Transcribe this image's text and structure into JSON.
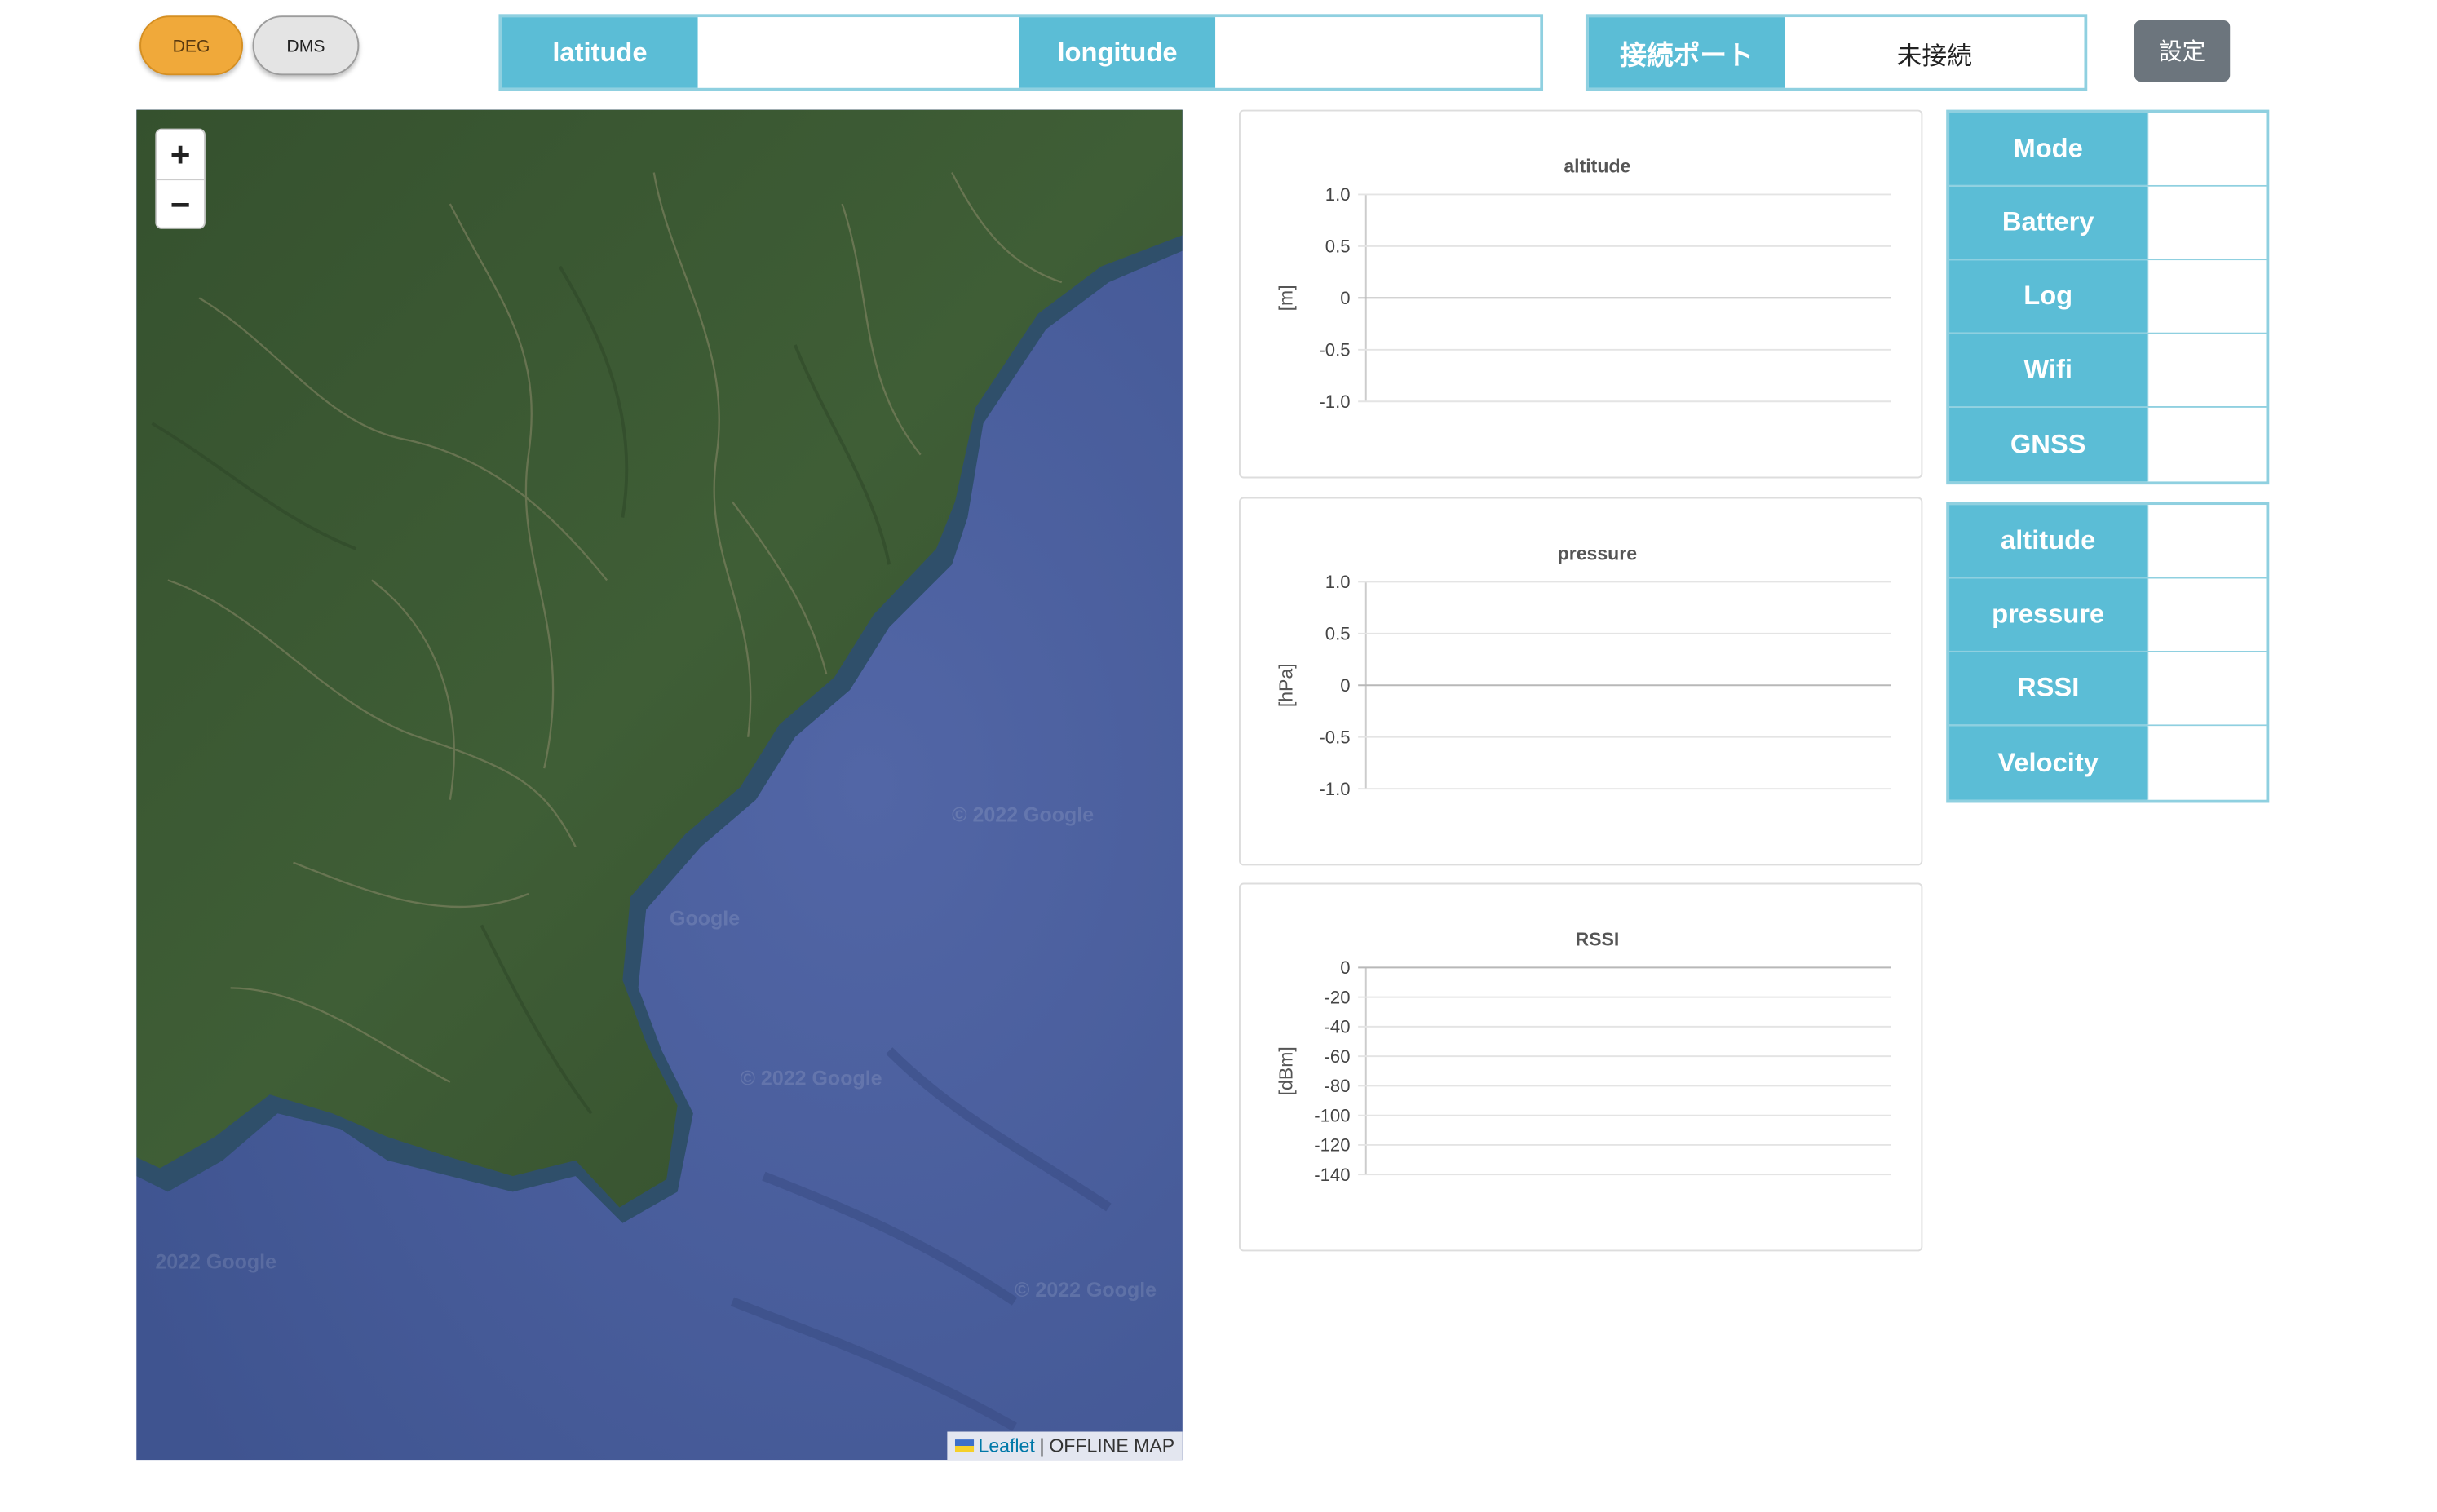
{
  "format_toggle": {
    "deg_label": "DEG",
    "dms_label": "DMS",
    "active": "DEG"
  },
  "coords": {
    "latitude_label": "latitude",
    "latitude_value": "",
    "longitude_label": "longitude",
    "longitude_value": ""
  },
  "port": {
    "label": "接続ポート",
    "value": "未接続"
  },
  "settings_button": "設定",
  "map": {
    "zoom_in": "+",
    "zoom_out": "−",
    "attribution_link": "Leaflet",
    "attribution_sep": "|",
    "attribution_text": "OFFLINE MAP",
    "watermarks": [
      "© 2022 Google",
      "Google",
      "© 2022 Google",
      "2022 Google",
      "© 2022 Google"
    ],
    "colors": {
      "sea": "#4a5f9c",
      "land": "#3c5a34"
    }
  },
  "status": [
    {
      "label": "Mode",
      "value": ""
    },
    {
      "label": "Battery",
      "value": ""
    },
    {
      "label": "Log",
      "value": ""
    },
    {
      "label": "Wifi",
      "value": ""
    },
    {
      "label": "GNSS",
      "value": ""
    }
  ],
  "telemetry": [
    {
      "label": "altitude",
      "value": ""
    },
    {
      "label": "pressure",
      "value": ""
    },
    {
      "label": "RSSI",
      "value": ""
    },
    {
      "label": "Velocity",
      "value": ""
    }
  ],
  "chart_data": [
    {
      "type": "line",
      "title": "altitude",
      "ylabel": "[m]",
      "xlabel": "",
      "x": [],
      "series": [],
      "ylim": [
        -1.0,
        1.0
      ],
      "yticks": [
        1.0,
        0.5,
        0,
        -0.5,
        -1.0
      ],
      "ytick_labels": [
        "1.0",
        "0.5",
        "0",
        "-0.5",
        "-1.0"
      ],
      "grid": true
    },
    {
      "type": "line",
      "title": "pressure",
      "ylabel": "[hPa]",
      "xlabel": "",
      "x": [],
      "series": [],
      "ylim": [
        -1.0,
        1.0
      ],
      "yticks": [
        1.0,
        0.5,
        0,
        -0.5,
        -1.0
      ],
      "ytick_labels": [
        "1.0",
        "0.5",
        "0",
        "-0.5",
        "-1.0"
      ],
      "grid": true
    },
    {
      "type": "line",
      "title": "RSSI",
      "ylabel": "[dBm]",
      "xlabel": "",
      "x": [],
      "series": [],
      "ylim": [
        -140,
        0
      ],
      "yticks": [
        0,
        -20,
        -40,
        -60,
        -80,
        -100,
        -120,
        -140
      ],
      "ytick_labels": [
        "0",
        "-20",
        "-40",
        "-60",
        "-80",
        "-100",
        "-120",
        "-140"
      ],
      "grid": true
    }
  ],
  "colors": {
    "accent": "#5bbdd6",
    "accent_border": "#8fd0e0",
    "deg_active": "#f0a93a",
    "settings": "#6c757d"
  }
}
